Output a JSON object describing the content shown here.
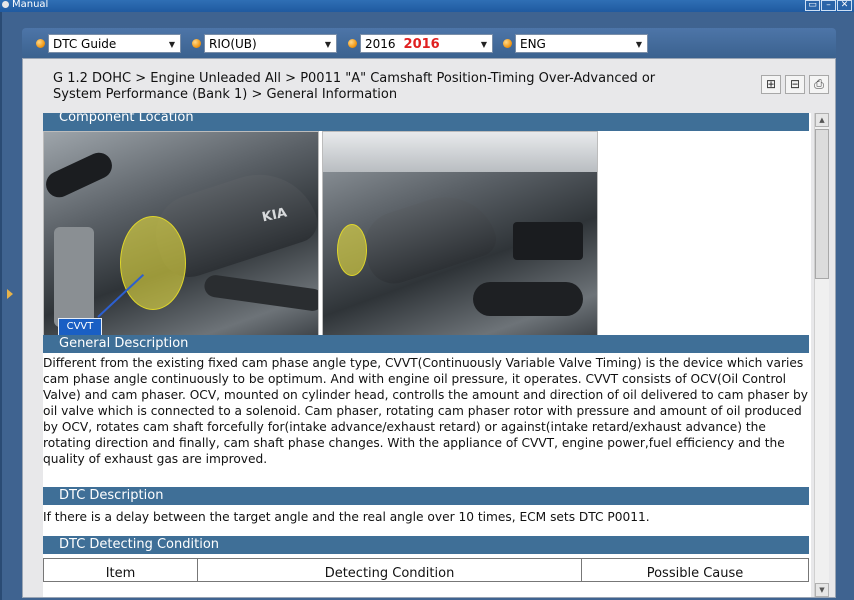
{
  "window": {
    "title": "Manual"
  },
  "toolbar": {
    "guide": "DTC Guide",
    "model": "RIO(UB)",
    "year": "2016",
    "year_highlight": "2016",
    "language": "ENG"
  },
  "breadcrumb": {
    "line1": "G 1.2 DOHC > Engine Unleaded All > P0011 \"A\" Camshaft Position-Timing Over-Advanced or",
    "line2": "System Performance (Bank 1) > General Information"
  },
  "sections": {
    "component_location": "Component Location",
    "general_description": "General Description",
    "dtc_description": "DTC Description",
    "dtc_detecting_condition": "DTC Detecting Condition"
  },
  "photo": {
    "label": "CVVT",
    "badge_text": "KIA"
  },
  "text": {
    "general_description": "Different from the existing fixed cam phase angle type, CVVT(Continuously Variable Valve Timing) is the device which varies cam phase angle continuously to be optimum. And with engine oil pressure, it operates. CVVT consists of OCV(Oil Control Valve) and cam phaser. OCV, mounted on cylinder head, controlls the amount and direction of oil delivered to cam phaser by oil valve which is connected to a solenoid. Cam phaser, rotating cam phaser rotor with pressure and amount of oil produced by OCV, rotates cam shaft forcefully for(intake advance/exhaust retard) or against(intake retard/exhaust advance) the rotating direction and finally, cam shaft phase changes. With the appliance of CVVT, engine power,fuel efficiency and the quality of exhaust gas are improved.",
    "dtc_description": "If there is a delay between the target angle and the real angle over 10 times, ECM sets DTC P0011."
  },
  "table": {
    "columns": [
      "Item",
      "Detecting Condition",
      "Possible Cause"
    ]
  },
  "icons": [
    "app-icon",
    "minimize-icon",
    "restore-icon",
    "close-icon",
    "print-icon",
    "chevron-up-icon",
    "chevron-down-icon"
  ]
}
